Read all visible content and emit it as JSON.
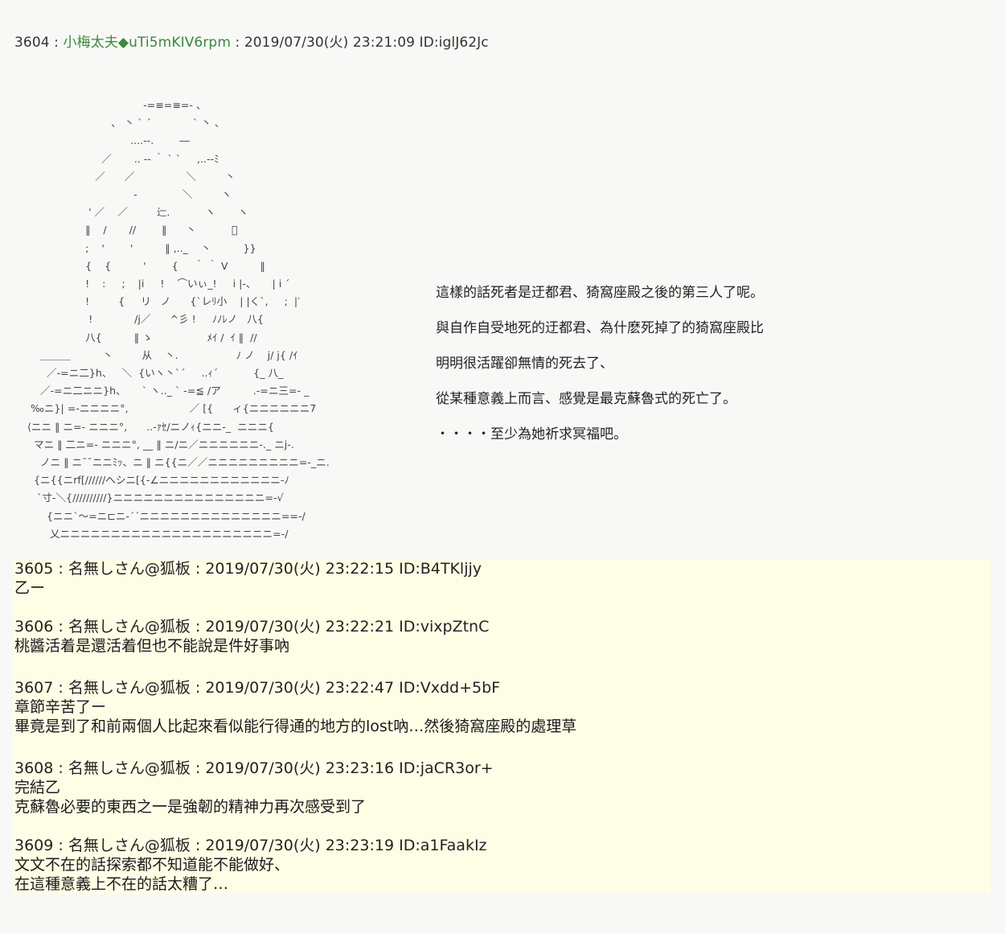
{
  "main_post": {
    "number": "3604",
    "name": "小梅太夫",
    "trip": "◆uTi5mKIV6rpm",
    "datetime": "2019/07/30(火) 23:21:09",
    "id": "ID:iglJ62Jc",
    "ascii_art": [
      "                                        -=≡=≡=- 、",
      "                              、 丶 ` ´             ` 丶 、",
      "                                    ....-‐.        ―",
      "                           ／       .. -‐ ｀ ` `     ,..--ﾐ",
      "                         ／      ／                ＼         丶",
      "                                     ‐              ＼         ヽ",
      "                       ' ／    ／         辷.           ヽ       ヽ",
      "                      ‖    /       //        ‖      丶           ゙",
      "                      ;    '        '          ‖ ,.._    丶          }}",
      "                      {    {          '        {     ｀ ｀ V          ‖",
      "                      !    :     ;    |i     !    ⌒いぃ_!     i |-、     | i ´",
      "                      !         {     リ   ノ      {`レﾘ小    | |く`,     ;  |′",
      "                       !             /j／      ^彡 !     ﾉﾉﾚノ   八{",
      "                      八{          ‖ ゝ                 ﾒｲ /  ｲ ‖  //",
      "        ＿＿＿          丶         从    丶.                  ﾉ ノ    j/ j{ /ｲ",
      "          ／-=ニ二}h、   ＼  {いヽ丶`´     ..ｨ´           {_ 八_",
      "        ／-=ニ二ニニ}h、     ` ヽ.._ ` ‐=≦ /ア          .-=ニ三=- _",
      "     ‰ニ}| =-ニニニニ°,                   ／ [{      ィ{ニニニニニニ7",
      "    ⟨ニニ ‖ ニ=- ニニニ°,      ..-ｧｾ/ニノｨ{ニニ-_  ニニニ{",
      "      マニ ‖ 二ニ=- ニニニ°, __ ‖ ニ/ニ／ニニニニニニ-._ ニj-.",
      "        ノニ ‖ ニ¯¯ニニﾐｯ、ニ ‖ ニ{{ニ／／ニニニニニニニニニ=-_ニ.",
      "      {ニ{{ニrf[//////へシニ[{-∠ニニニニニニニニニニニニ-ﾉ",
      "       `寸-＼{//////////}ニニニニニニニニニニニニニニニ=-√",
      "          {ニニ`～=ニ⊏ニ-´´ニニニニニニニニニニニニニニ==-/",
      "           乂ニニニニニニニニニニニニニニニニニニニニニ=-/"
    ],
    "narration": [
      "這樣的話死者是迂都君、猗窩座殿之後的第三人了呢。",
      " 與自作自受地死的迂都君、為什麽死掉了的猗窩座殿比",
      "明明很活躍卻無情的死去了、",
      " 從某種意義上而言、感覺是最克蘇魯式的死亡了。",
      "  ・・・・至少為她祈求冥福吧。"
    ]
  },
  "replies": [
    {
      "number": "3605",
      "name": "名無しさん@狐板",
      "datetime": "2019/07/30(火) 23:22:15",
      "id": "ID:B4TKljjy",
      "lines": [
        "乙ー"
      ]
    },
    {
      "number": "3606",
      "name": "名無しさん@狐板",
      "datetime": "2019/07/30(火) 23:22:21",
      "id": "ID:vixpZtnC",
      "lines": [
        "桃醬活着是還活着但也不能說是件好事吶"
      ]
    },
    {
      "number": "3607",
      "name": "名無しさん@狐板",
      "datetime": "2019/07/30(火) 23:22:47",
      "id": "ID:Vxdd+5bF",
      "lines": [
        "章節辛苦了ー",
        "畢竟是到了和前兩個人比起來看似能行得通的地方的lost吶…然後猗窩座殿的處理草"
      ]
    },
    {
      "number": "3608",
      "name": "名無しさん@狐板",
      "datetime": "2019/07/30(火) 23:23:16",
      "id": "ID:jaCR3or+",
      "lines": [
        "完結乙",
        "克蘇魯必要的東西之一是強韌的精神力再次感受到了"
      ]
    },
    {
      "number": "3609",
      "name": "名無しさん@狐板",
      "datetime": "2019/07/30(火) 23:23:19",
      "id": "ID:a1FaakIz",
      "lines": [
        "文文不在的話探索都不知道能不能做好、",
        "在這種意義上不在的話太糟了…"
      ]
    }
  ]
}
